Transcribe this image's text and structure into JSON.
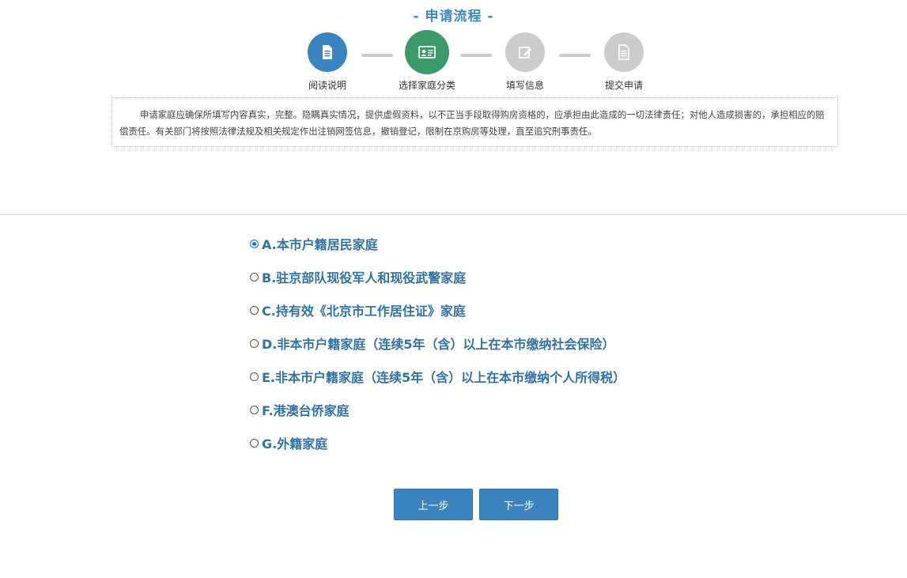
{
  "process": {
    "title": "- 申请流程 -",
    "steps": [
      {
        "label": "阅读说明",
        "icon": "document-icon",
        "color": "#3a84c2"
      },
      {
        "label": "选择家庭分类",
        "icon": "id-card-icon",
        "color": "#3a9a6a"
      },
      {
        "label": "填写信息",
        "icon": "edit-icon",
        "color": "#cccccc"
      },
      {
        "label": "提交申请",
        "icon": "document-icon",
        "color": "#cccccc"
      }
    ]
  },
  "notice": {
    "text": "申请家庭应确保所填写内容真实，完整。隐瞒真实情况，提供虚假资料，以不正当手段取得购房资格的，应承担由此造成的一切法律责任；对他人造成损害的，承担相应的赔偿责任。有关部门将按照法律法规及相关规定作出注销网签信息，撤销登记，限制在京购房等处理，直至追究刑事责任。"
  },
  "family_options": {
    "selected": "A",
    "items": [
      {
        "label": "A.本市户籍居民家庭",
        "checked": true
      },
      {
        "label": "B.驻京部队现役军人和现役武警家庭",
        "checked": false
      },
      {
        "label": "C.持有效《北京市工作居住证》家庭",
        "checked": false
      },
      {
        "label": "D.非本市户籍家庭（连续5年（含）以上在本市缴纳社会保险）",
        "checked": false
      },
      {
        "label": "E.非本市户籍家庭（连续5年（含）以上在本市缴纳个人所得税）",
        "checked": false
      },
      {
        "label": "F.港澳台侨家庭",
        "checked": false
      },
      {
        "label": "G.外籍家庭",
        "checked": false
      }
    ]
  },
  "buttons": {
    "prev_label": "上一步",
    "next_label": "下一步"
  },
  "colors": {
    "accent": "#3a8ac4",
    "option_text": "#2f72a8",
    "button_bg": "#3b84c0",
    "step_done": "#3a84c2",
    "step_current": "#3a9a6a",
    "step_pending": "#cccccc"
  }
}
